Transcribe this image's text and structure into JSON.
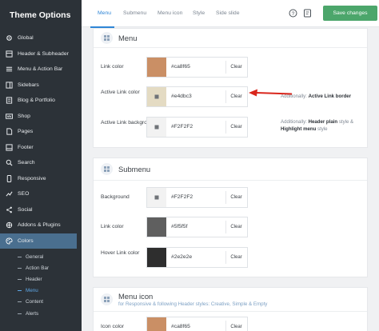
{
  "sidebar": {
    "title": "Theme Options",
    "items": [
      {
        "label": "Global",
        "icon": "gear-icon"
      },
      {
        "label": "Header & Subheader",
        "icon": "header-icon"
      },
      {
        "label": "Menu & Action Bar",
        "icon": "menu-icon"
      },
      {
        "label": "Sidebars",
        "icon": "sidebars-icon"
      },
      {
        "label": "Blog & Portfolio",
        "icon": "blog-icon"
      },
      {
        "label": "Shop",
        "icon": "shop-icon"
      },
      {
        "label": "Pages",
        "icon": "pages-icon"
      },
      {
        "label": "Footer",
        "icon": "footer-icon"
      },
      {
        "label": "Search",
        "icon": "search-icon"
      },
      {
        "label": "Responsive",
        "icon": "responsive-icon"
      },
      {
        "label": "SEO",
        "icon": "seo-icon"
      },
      {
        "label": "Social",
        "icon": "share-icon"
      },
      {
        "label": "Addons & Plugins",
        "icon": "plugin-icon"
      },
      {
        "label": "Colors",
        "icon": "palette-icon"
      }
    ],
    "subitems": [
      {
        "label": "General"
      },
      {
        "label": "Action Bar"
      },
      {
        "label": "Header"
      },
      {
        "label": "Menu"
      },
      {
        "label": "Content"
      },
      {
        "label": "Alerts"
      }
    ]
  },
  "tabs": [
    {
      "label": "Menu"
    },
    {
      "label": "Submenu"
    },
    {
      "label": "Menu icon"
    },
    {
      "label": "Style"
    },
    {
      "label": "Side slide"
    }
  ],
  "toolbar": {
    "save_label": "Save changes"
  },
  "sections": {
    "menu": {
      "title": "Menu",
      "rows": [
        {
          "label": "Link color",
          "value": "#ca8f65",
          "clear": "Clear"
        },
        {
          "label": "Active Link color",
          "value": "#e4dbc3",
          "clear": "Clear",
          "note_prefix": "Additionally: ",
          "note_bold": "Active Link border"
        },
        {
          "label": "Active Link background",
          "value": "#F2F2F2",
          "clear": "Clear",
          "note_prefix": "Additionally: ",
          "note_bold": "Header plain",
          "note_mid": " style & ",
          "note_bold2": "Highlight menu",
          "note_suffix": " style"
        }
      ]
    },
    "submenu": {
      "title": "Submenu",
      "rows": [
        {
          "label": "Background",
          "value": "#F2F2F2",
          "clear": "Clear"
        },
        {
          "label": "Link color",
          "value": "#5f5f5f",
          "clear": "Clear"
        },
        {
          "label": "Hover Link color",
          "value": "#2e2e2e",
          "clear": "Clear"
        }
      ]
    },
    "menu_icon": {
      "title": "Menu icon",
      "subtitle": "for Responsive & following Header styles: Creative, Simple & Empty",
      "rows": [
        {
          "label": "Icon color",
          "value": "#ca8f65",
          "clear": "Clear"
        }
      ]
    }
  },
  "colors": {
    "accent": "#2f86d6",
    "save": "#4ca66b",
    "sidebar_bg": "#2c3238",
    "active_item": "#4a6f8f",
    "arrow": "#d9261c"
  }
}
